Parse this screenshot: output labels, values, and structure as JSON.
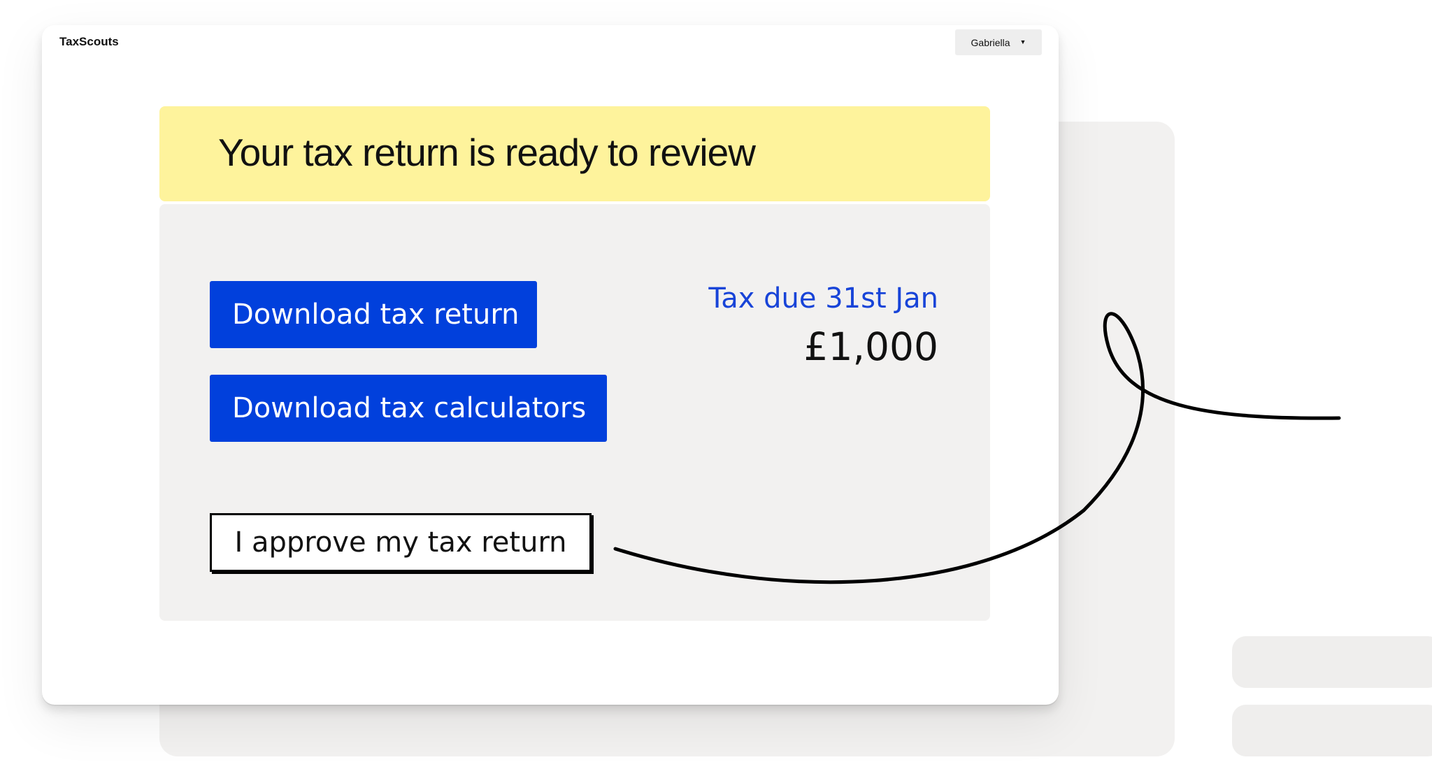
{
  "app": {
    "brand": "TaxScouts",
    "user_menu": {
      "name": "Gabriella",
      "caret_icon": "chevron-down-icon"
    }
  },
  "banner": {
    "title": "Your tax return is ready to review"
  },
  "actions": {
    "download_return": "Download tax return",
    "download_calculators": "Download tax calculators",
    "approve": "I approve my tax return"
  },
  "tax_due": {
    "label": "Tax due 31st Jan",
    "amount": "£1,000"
  },
  "colors": {
    "primary_blue": "#0140dc",
    "due_label_blue": "#1844d8",
    "banner_yellow": "#fef39c",
    "panel_grey": "#f2f1f0"
  }
}
